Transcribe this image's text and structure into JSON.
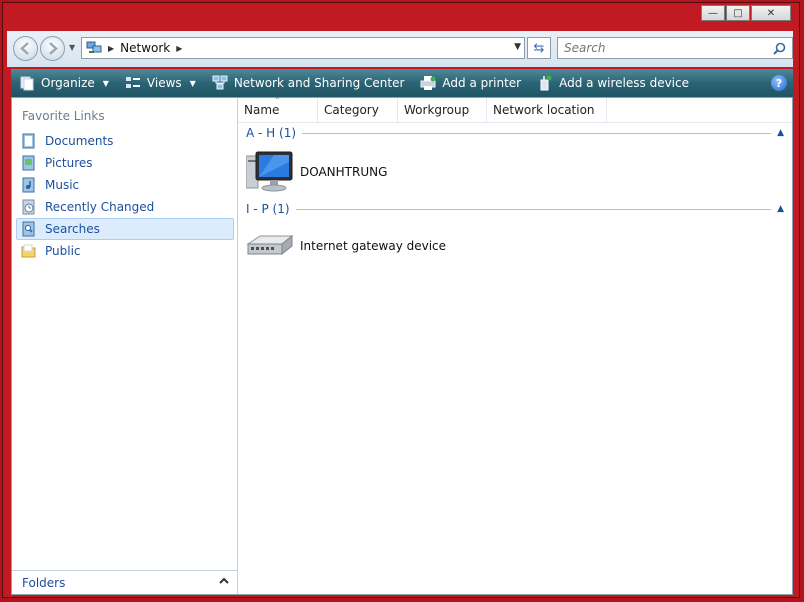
{
  "address": {
    "location": "Network"
  },
  "search": {
    "placeholder": "Search"
  },
  "toolbar": {
    "organize": "Organize",
    "views": "Views",
    "network_sharing": "Network and Sharing Center",
    "add_printer": "Add a printer",
    "add_wireless": "Add a wireless device",
    "help": "?"
  },
  "sidebar": {
    "title": "Favorite Links",
    "items": [
      {
        "label": "Documents"
      },
      {
        "label": "Pictures"
      },
      {
        "label": "Music"
      },
      {
        "label": "Recently Changed"
      },
      {
        "label": "Searches"
      },
      {
        "label": "Public"
      }
    ],
    "folders": "Folders"
  },
  "columns": [
    "Name",
    "Category",
    "Workgroup",
    "Network location"
  ],
  "groups": [
    {
      "label": "A - H (1)",
      "items": [
        {
          "name": "DOANHTRUNG",
          "icon": "computer-icon"
        }
      ]
    },
    {
      "label": "I - P (1)",
      "items": [
        {
          "name": "Internet gateway device",
          "icon": "gateway-router-icon"
        }
      ]
    }
  ],
  "colors": {
    "toolbar": "#2b6475",
    "link": "#1c4f9c",
    "frame": "#c21a22",
    "selection": "#dcecfc"
  }
}
